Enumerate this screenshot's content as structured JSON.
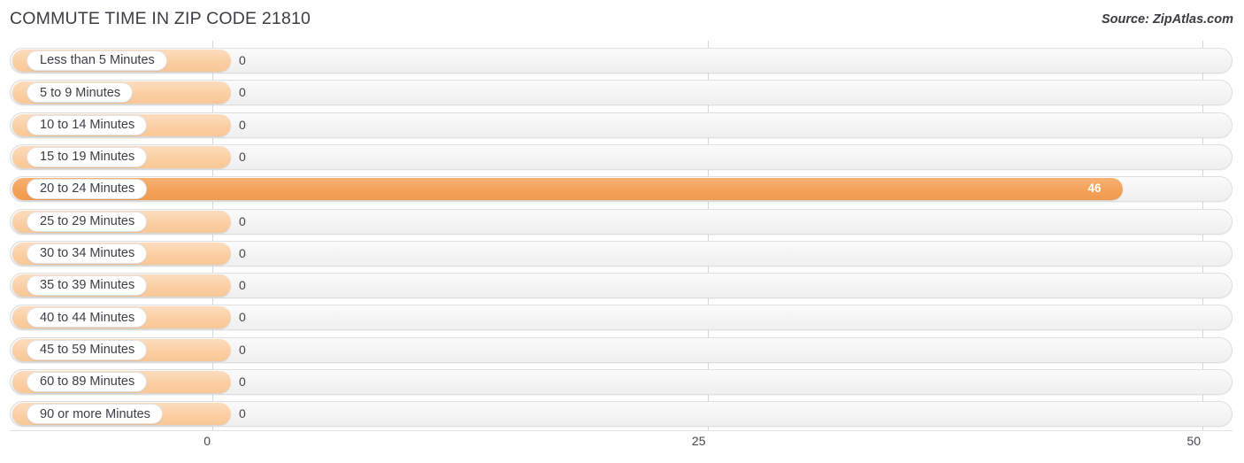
{
  "header": {
    "title": "COMMUTE TIME IN ZIP CODE 21810",
    "source": "Source: ZipAtlas.com"
  },
  "chart_data": {
    "type": "bar",
    "orientation": "horizontal",
    "title": "COMMUTE TIME IN ZIP CODE 21810",
    "xlabel": "",
    "ylabel": "",
    "xlim": [
      0,
      50
    ],
    "xticks": [
      "0",
      "25",
      "50"
    ],
    "xtick_values": [
      0,
      25,
      50
    ],
    "grid": true,
    "legend": false,
    "accent_color": "#f4a259",
    "zero_color": "#fbcfa4",
    "categories": [
      "Less than 5 Minutes",
      "5 to 9 Minutes",
      "10 to 14 Minutes",
      "15 to 19 Minutes",
      "20 to 24 Minutes",
      "25 to 29 Minutes",
      "30 to 34 Minutes",
      "35 to 39 Minutes",
      "40 to 44 Minutes",
      "45 to 59 Minutes",
      "60 to 89 Minutes",
      "90 or more Minutes"
    ],
    "values": [
      0,
      0,
      0,
      0,
      46,
      0,
      0,
      0,
      0,
      0,
      0,
      0
    ],
    "value_labels": [
      "0",
      "0",
      "0",
      "0",
      "46",
      "0",
      "0",
      "0",
      "0",
      "0",
      "0",
      "0"
    ]
  }
}
